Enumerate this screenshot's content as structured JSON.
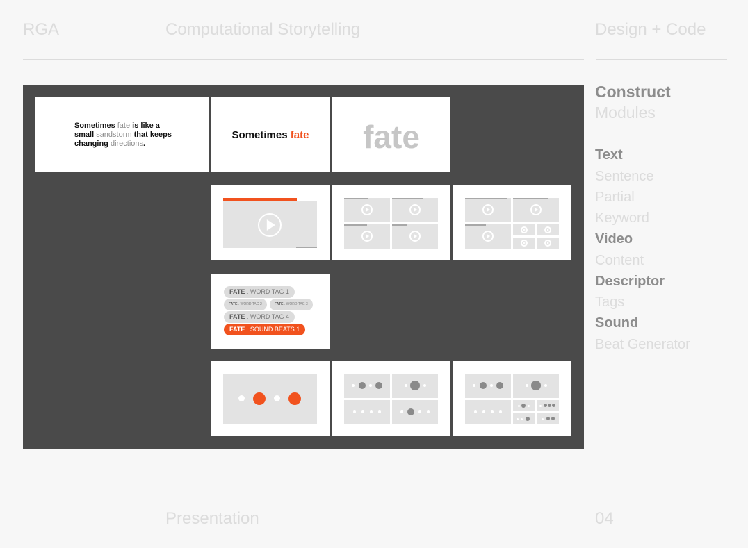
{
  "header": {
    "left": "RGA",
    "center": "Computational Storytelling",
    "right": "Design + Code"
  },
  "footer": {
    "left": "Presentation",
    "page": "04"
  },
  "sidebar": {
    "title": "Construct",
    "subtitle": "Modules",
    "groups": [
      {
        "label": "Text",
        "items": [
          "Sentence",
          "Partial",
          "Keyword"
        ]
      },
      {
        "label": "Video",
        "items": [
          "Content"
        ]
      },
      {
        "label": "Descriptor",
        "items": [
          "Tags"
        ]
      },
      {
        "label": "Sound",
        "items": [
          "Beat Generator"
        ]
      }
    ]
  },
  "text_cards": {
    "sentence": {
      "p1": "Sometimes ",
      "fate": "fate",
      "p2": " is like a small ",
      "sandstorm": "sandstorm",
      "p3": " that keeps changing ",
      "directions": "directions",
      "p4": "."
    },
    "partial": {
      "prefix": "Sometimes ",
      "accent": "fate"
    },
    "keyword": "fate"
  },
  "tags": [
    {
      "key": "FATE",
      "sep": " . ",
      "label": "WORD TAG 1"
    },
    {
      "key": "FATE",
      "sep": " . ",
      "label": "WORD TAG 2"
    },
    {
      "key": "FATE",
      "sep": " . ",
      "label": "WORD TAG 3"
    },
    {
      "key": "FATE",
      "sep": " . ",
      "label": "WORD TAG 4"
    },
    {
      "key": "FATE",
      "sep": " . ",
      "label": "SOUND BEATS 1"
    }
  ],
  "colors": {
    "accent": "#f1521e",
    "board": "#4a4a4a",
    "panel": "#e3e3e3"
  },
  "icons": [
    "play-icon",
    "beat-dot-icon"
  ]
}
